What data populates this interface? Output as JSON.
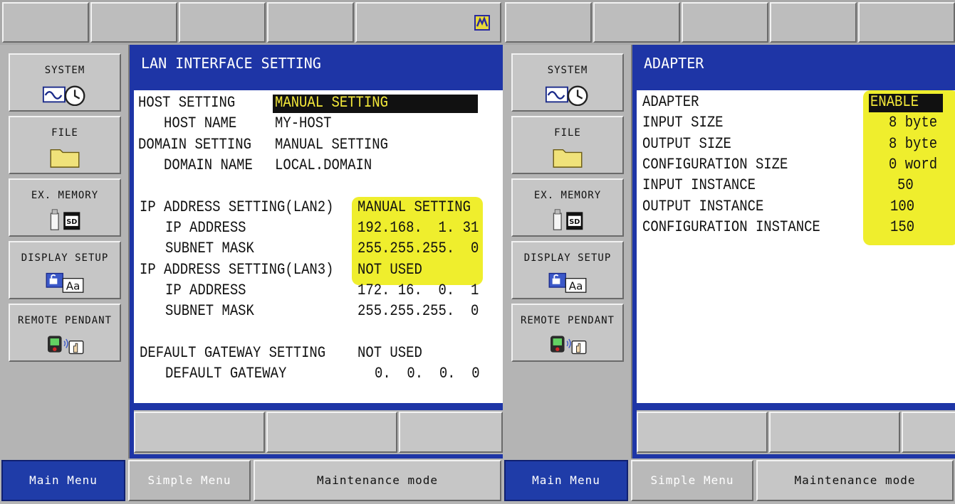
{
  "menu": {
    "system": "SYSTEM",
    "file": "FILE",
    "ex_memory": "EX. MEMORY",
    "display_setup": "DISPLAY SETUP",
    "remote_pendant": "REMOTE PENDANT"
  },
  "bottom": {
    "main_menu": "Main Menu",
    "simple_menu": "Simple Menu",
    "maintenance_mode": "Maintenance mode"
  },
  "icons": {
    "top_right": "robot-status-icon",
    "system": "waveform-clock-icon",
    "file": "folder-icon",
    "ex_memory": "usb-sd-card-icon",
    "display_setup": "lock-font-icon",
    "remote_pendant": "pendant-tablet-icon"
  },
  "colors": {
    "title_bar": "#1e35a6",
    "highlight": "#efee2d",
    "main_menu_active": "#1f3ca8"
  },
  "left_screen": {
    "title": "LAN INTERFACE SETTING",
    "rows": {
      "host_setting": {
        "label": "HOST SETTING",
        "value": "MANUAL SETTING"
      },
      "host_name": {
        "label": "HOST NAME",
        "value": "MY-HOST"
      },
      "domain_setting": {
        "label": "DOMAIN SETTING",
        "value": "MANUAL SETTING"
      },
      "domain_name": {
        "label": "DOMAIN NAME",
        "value": "LOCAL.DOMAIN"
      },
      "ip_lan2": {
        "label": "IP ADDRESS SETTING(LAN2)",
        "value": "MANUAL SETTING"
      },
      "ip_lan2_addr": {
        "label": "IP ADDRESS",
        "value": "192.168.  1. 31"
      },
      "ip_lan2_mask": {
        "label": "SUBNET MASK",
        "value": "255.255.255.  0"
      },
      "ip_lan3": {
        "label": "IP ADDRESS SETTING(LAN3)",
        "value": "NOT USED"
      },
      "ip_lan3_addr": {
        "label": "IP ADDRESS",
        "value": "172. 16.  0.  1"
      },
      "ip_lan3_mask": {
        "label": "SUBNET MASK",
        "value": "255.255.255.  0"
      },
      "gateway_setting": {
        "label": "DEFAULT GATEWAY SETTING",
        "value": "NOT USED"
      },
      "gateway": {
        "label": "DEFAULT GATEWAY",
        "value": "0.  0.  0.  0"
      }
    }
  },
  "right_screen": {
    "title": "ADAPTER",
    "rows": {
      "adapter": {
        "label": "ADAPTER",
        "value": "ENABLE"
      },
      "input_size": {
        "label": "INPUT SIZE",
        "value": "8 byte"
      },
      "output_size": {
        "label": "OUTPUT SIZE",
        "value": "8 byte"
      },
      "config_size": {
        "label": "CONFIGURATION SIZE",
        "value": "0 word"
      },
      "input_instance": {
        "label": "INPUT INSTANCE",
        "value": "50"
      },
      "output_instance": {
        "label": "OUTPUT INSTANCE",
        "value": "100"
      },
      "config_instance": {
        "label": "CONFIGURATION INSTANCE",
        "value": "150"
      }
    }
  }
}
